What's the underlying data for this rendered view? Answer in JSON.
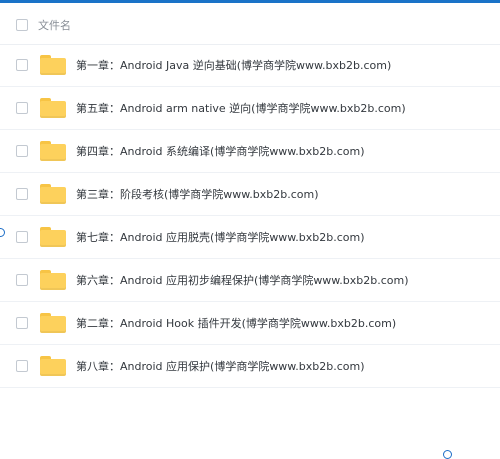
{
  "header": {
    "column_label": "文件名"
  },
  "files": [
    {
      "name": "第一章：Android Java 逆向基础(博学商学院www.bxb2b.com)",
      "icon": "folder-icon"
    },
    {
      "name": "第五章：Android arm native 逆向(博学商学院www.bxb2b.com)",
      "icon": "folder-icon"
    },
    {
      "name": "第四章：Android 系统编译(博学商学院www.bxb2b.com)",
      "icon": "folder-icon"
    },
    {
      "name": "第三章：阶段考核(博学商学院www.bxb2b.com)",
      "icon": "folder-icon"
    },
    {
      "name": "第七章：Android 应用脱壳(博学商学院www.bxb2b.com)",
      "icon": "folder-icon"
    },
    {
      "name": "第六章：Android 应用初步编程保护(博学商学院www.bxb2b.com)",
      "icon": "folder-icon"
    },
    {
      "name": "第二章：Android Hook 插件开发(博学商学院www.bxb2b.com)",
      "icon": "folder-icon"
    },
    {
      "name": "第八章：Android 应用保护(博学商学院www.bxb2b.com)",
      "icon": "folder-icon"
    }
  ],
  "colors": {
    "accent": "#1a73c8",
    "folder": "#fdd15c",
    "text": "#33383e",
    "muted": "#888e96"
  }
}
